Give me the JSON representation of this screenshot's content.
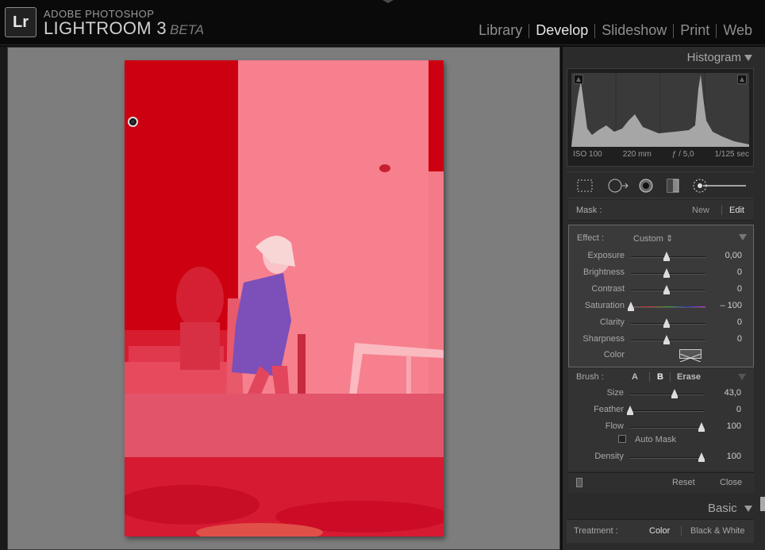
{
  "app": {
    "logo": "Lr",
    "brand_small": "ADOBE PHOTOSHOP",
    "brand_title": "LIGHTROOM 3",
    "brand_beta": "BETA"
  },
  "modules": [
    {
      "label": "Library",
      "active": false
    },
    {
      "label": "Develop",
      "active": true
    },
    {
      "label": "Slideshow",
      "active": false
    },
    {
      "label": "Print",
      "active": false
    },
    {
      "label": "Web",
      "active": false
    }
  ],
  "histogram": {
    "title": "Histogram",
    "iso": "ISO 100",
    "focal": "220 mm",
    "aperture": "ƒ / 5,0",
    "shutter": "1/125 sec"
  },
  "mask": {
    "label": "Mask :",
    "new_label": "New",
    "edit_label": "Edit"
  },
  "effect": {
    "label": "Effect :",
    "preset": "Custom ⇕",
    "sliders": [
      {
        "name": "Exposure",
        "value": "0,00",
        "position": 0.5
      },
      {
        "name": "Brightness",
        "value": "0",
        "position": 0.5
      },
      {
        "name": "Contrast",
        "value": "0",
        "position": 0.5
      },
      {
        "name": "Saturation",
        "value": "– 100",
        "position": 0.0
      },
      {
        "name": "Clarity",
        "value": "0",
        "position": 0.5
      },
      {
        "name": "Sharpness",
        "value": "0",
        "position": 0.5
      }
    ],
    "color_label": "Color"
  },
  "brush": {
    "label": "Brush :",
    "a_label": "A",
    "b_label": "B",
    "erase_label": "Erase",
    "sliders": [
      {
        "name": "Size",
        "value": "43,0",
        "position": 0.62
      },
      {
        "name": "Feather",
        "value": "0",
        "position": 0.0
      },
      {
        "name": "Flow",
        "value": "100",
        "position": 1.0
      }
    ],
    "auto_mask_label": "Auto Mask",
    "density": {
      "name": "Density",
      "value": "100",
      "position": 1.0
    }
  },
  "footer": {
    "reset_label": "Reset",
    "close_label": "Close"
  },
  "basic": {
    "title": "Basic",
    "treatment_label": "Treatment :",
    "color_label": "Color",
    "bw_label": "Black & White"
  },
  "colors": {
    "mask_overlay": "#f27685",
    "panel_bg": "#2b2b2b",
    "canvas_bg": "#7d7d7d"
  }
}
